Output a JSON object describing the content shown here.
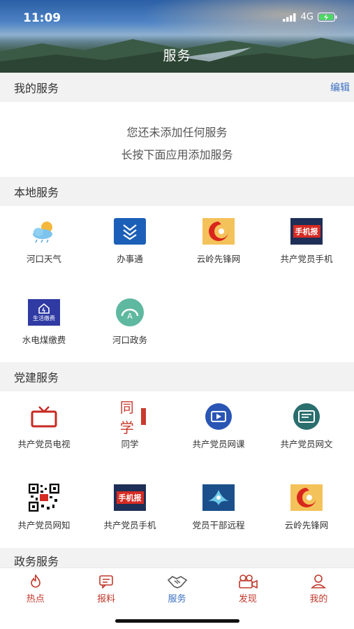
{
  "status": {
    "time": "11:09",
    "network": "4G"
  },
  "header": {
    "title": "服务"
  },
  "my_services": {
    "title": "我的服务",
    "edit_label": "编辑",
    "empty_line1": "您还未添加任何服务",
    "empty_line2": "长按下面应用添加服务"
  },
  "local_services": {
    "title": "本地服务",
    "items": [
      {
        "label": "河口天气",
        "icon": "weather-icon"
      },
      {
        "label": "办事通",
        "icon": "banshitong-icon"
      },
      {
        "label": "云岭先锋网",
        "icon": "yunling-icon"
      },
      {
        "label": "共产党员手机",
        "icon": "shoujibao-icon"
      },
      {
        "label": "水电煤缴费",
        "icon": "utility-payment-icon",
        "icon_text": "生活缴费"
      },
      {
        "label": "河口政务",
        "icon": "hekou-gov-icon"
      }
    ]
  },
  "party_services": {
    "title": "党建服务",
    "items": [
      {
        "label": "共产党员电视",
        "icon": "tv-icon"
      },
      {
        "label": "同学",
        "icon": "tongxue-icon",
        "icon_text": "同学"
      },
      {
        "label": "共产党员网课",
        "icon": "online-course-icon"
      },
      {
        "label": "共产党员网文",
        "icon": "article-icon"
      },
      {
        "label": "共产党员网知",
        "icon": "qr-code-icon"
      },
      {
        "label": "共产党员手机",
        "icon": "shoujibao-icon"
      },
      {
        "label": "党员干部远程",
        "icon": "remote-education-icon"
      },
      {
        "label": "云岭先锋网",
        "icon": "yunling-icon"
      }
    ]
  },
  "gov_services": {
    "title": "政务服务"
  },
  "shoujibao_text": "手机报",
  "tabs": [
    {
      "label": "热点",
      "icon": "flame-icon"
    },
    {
      "label": "报料",
      "icon": "message-icon"
    },
    {
      "label": "服务",
      "icon": "handshake-icon",
      "active": true
    },
    {
      "label": "发现",
      "icon": "video-camera-icon"
    },
    {
      "label": "我的",
      "icon": "person-icon"
    }
  ],
  "colors": {
    "accent_blue": "#3a6fc2",
    "tab_red": "#c0392b",
    "section_bg": "#f2f2f2"
  }
}
